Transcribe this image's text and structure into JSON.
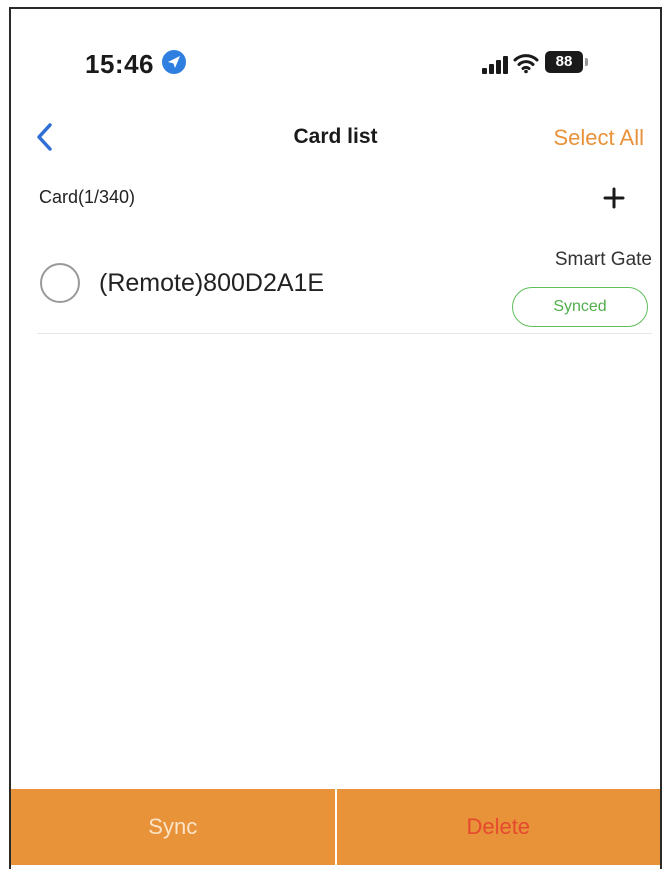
{
  "status_bar": {
    "time": "15:46",
    "battery": "88",
    "icons": [
      "location-arrow-icon",
      "cellular-signal-icon",
      "wifi-icon",
      "battery-icon"
    ]
  },
  "nav": {
    "title": "Card list",
    "select_all": "Select All",
    "back_icon": "chevron-left-icon"
  },
  "card_header": {
    "count_label": "Card(1/340)",
    "add_icon": "plus-icon"
  },
  "cards": [
    {
      "name": "(Remote)800D2A1E",
      "device": "Smart Gate",
      "status": "Synced",
      "selected": false
    }
  ],
  "bottom_bar": {
    "sync_label": "Sync",
    "delete_label": "Delete"
  },
  "colors": {
    "accent": "#e8923a",
    "synced": "#4fae4a",
    "delete": "#e64a2e",
    "back": "#2f6fd6"
  }
}
